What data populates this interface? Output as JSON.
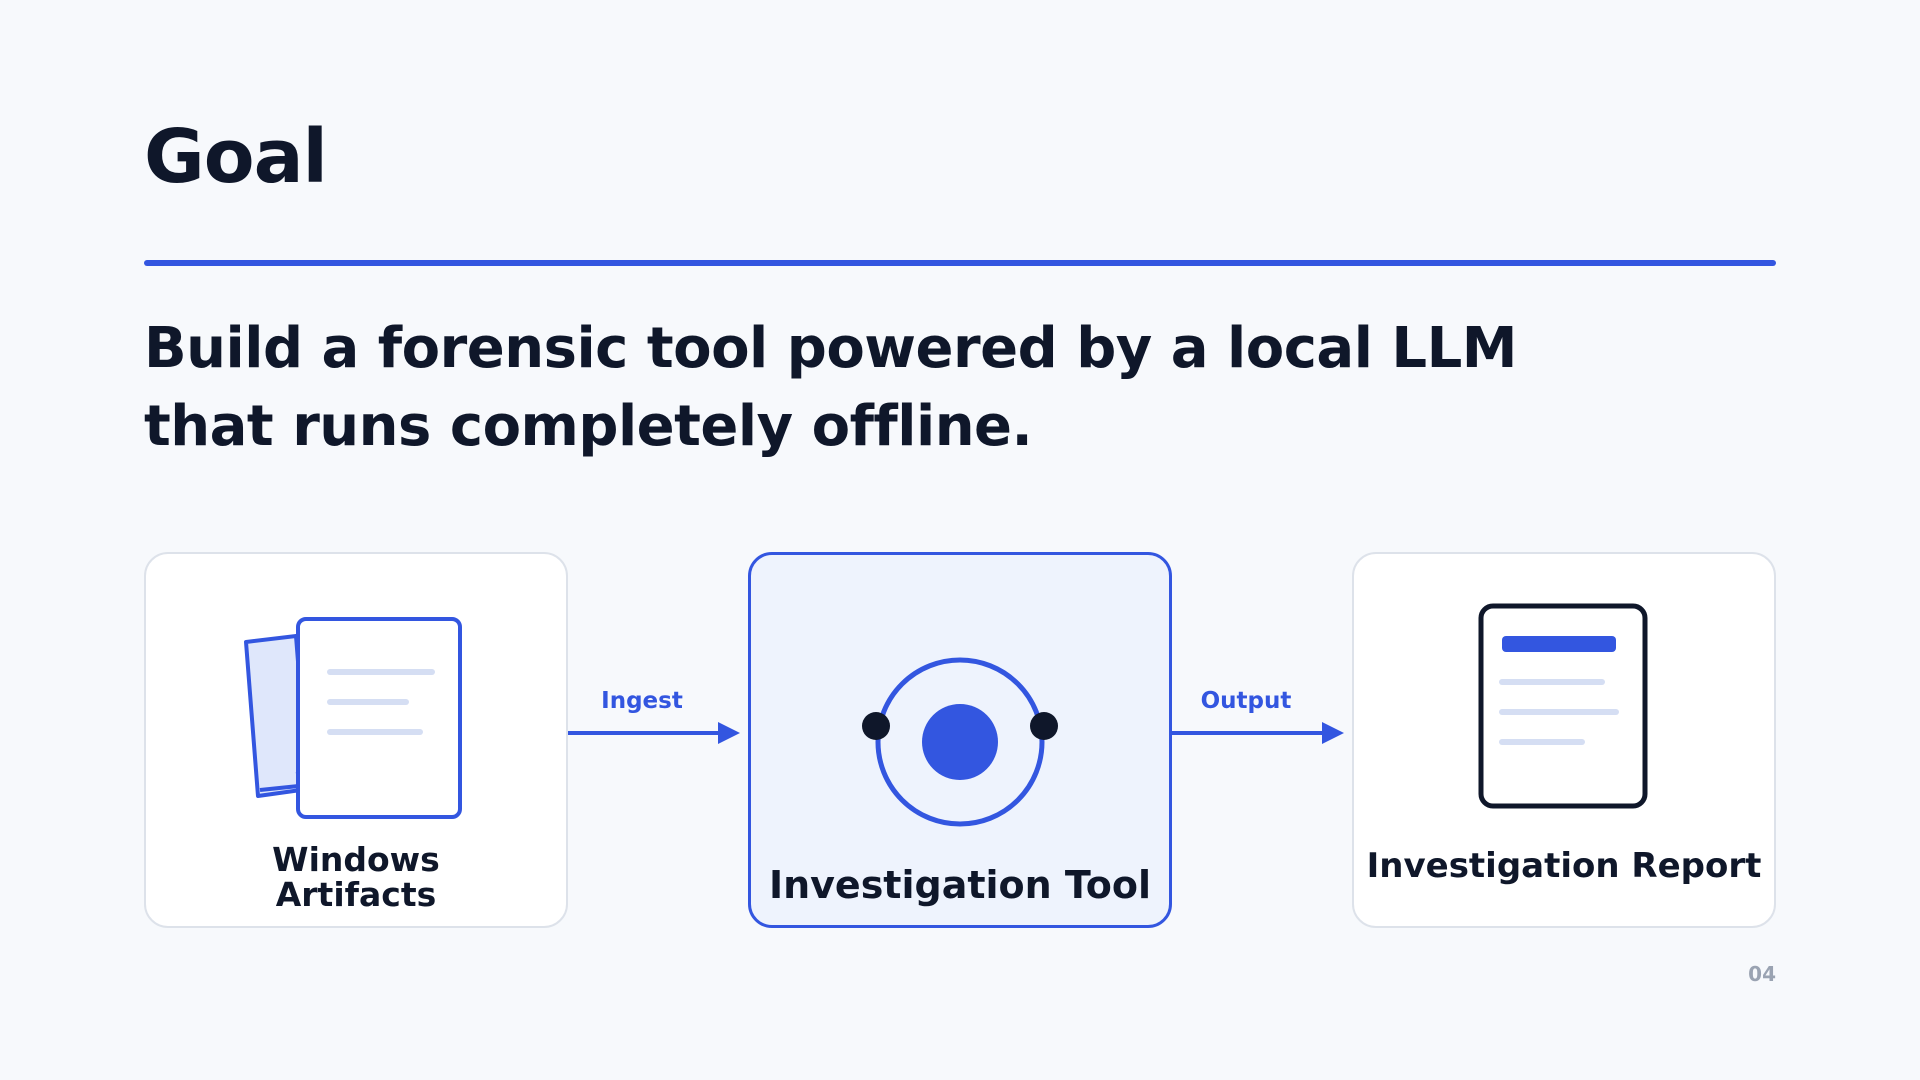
{
  "title": "Goal",
  "subtitle": {
    "line1": "Build a forensic tool powered by a local LLM",
    "line2": "that runs completely offline."
  },
  "flow": {
    "input_label_line1": "Windows",
    "input_label_line2": "Artifacts",
    "tool_label": "Investigation Tool",
    "output_label": "Investigation Report",
    "ingest_label": "Ingest",
    "output_arrow_label": "Output"
  },
  "page_number": "04",
  "colors": {
    "accent": "#3356e0",
    "ink": "#0f172a",
    "accent_light": "#dfe7fb",
    "muted": "#9aa3b2"
  },
  "icons": {
    "input": "documents-icon",
    "tool": "llm-core-icon",
    "output": "report-icon"
  }
}
